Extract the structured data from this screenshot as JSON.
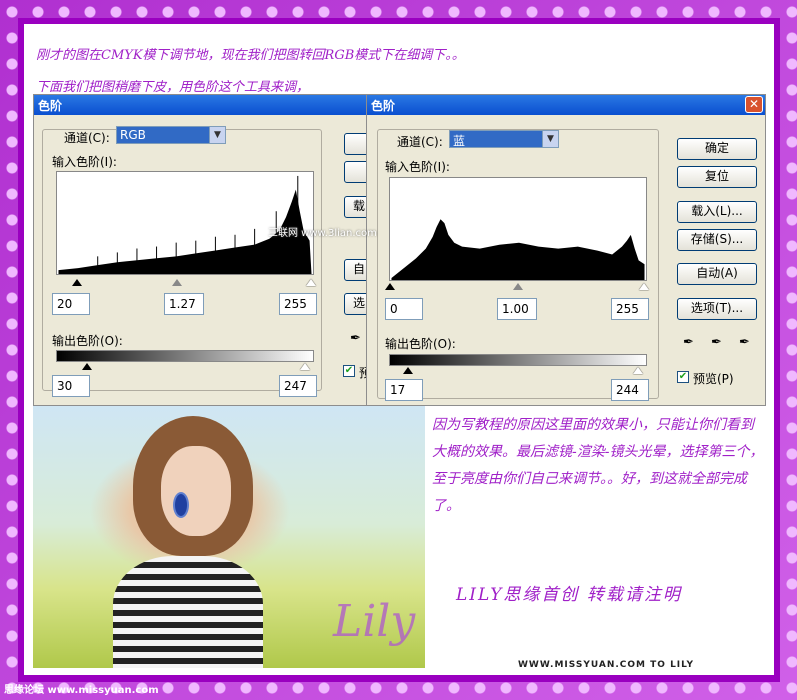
{
  "notes": {
    "line1": "刚才的图在CMYK模下调节地，现在我们把图转回RGB模式下在细调下。。",
    "line2": "下面我们把图稍磨下皮，用色阶这个工具来调，",
    "tutorial_text": "因为写教程的原因这里面的效果小，只能让你们看到大概的效果。最后滤镜-渲染-镜头光晕，选择第三个，至于亮度由你们自己来调节。。好，到这就全部完成了。",
    "credit": "LILY思缘首创   转载请注明",
    "footer_site": "WWW.MISSYUAN.COM TO LILY",
    "bottom_label": "思缘论坛 www.missyuan.com",
    "watermark": "三联网 www.3lian.com",
    "signature": "Lily"
  },
  "dialog_left": {
    "title": "色阶",
    "channel_label": "通道(C):",
    "channel_value": "RGB",
    "input_label": "输入色阶(I):",
    "input_values": [
      "20",
      "1.27",
      "255"
    ],
    "output_label": "输出色阶(O):",
    "output_values": [
      "30",
      "247"
    ],
    "buttons": [
      "",
      "",
      "载",
      "自",
      "选"
    ],
    "preview_label": "预"
  },
  "dialog_right": {
    "title": "色阶",
    "channel_label": "通道(C):",
    "channel_value": "蓝",
    "input_label": "输入色阶(I):",
    "input_values": [
      "0",
      "1.00",
      "255"
    ],
    "output_label": "输出色阶(O):",
    "output_values": [
      "17",
      "244"
    ],
    "buttons": {
      "ok": "确定",
      "reset": "复位",
      "load": "载入(L)...",
      "save": "存储(S)...",
      "auto": "自动(A)",
      "options": "选项(T)..."
    },
    "preview_label": "预览(P)",
    "close_symbol": "✕"
  },
  "colors": {
    "accent": "#a020c8",
    "titlebar": "#0a4fd0",
    "frame": "#c040d8"
  }
}
